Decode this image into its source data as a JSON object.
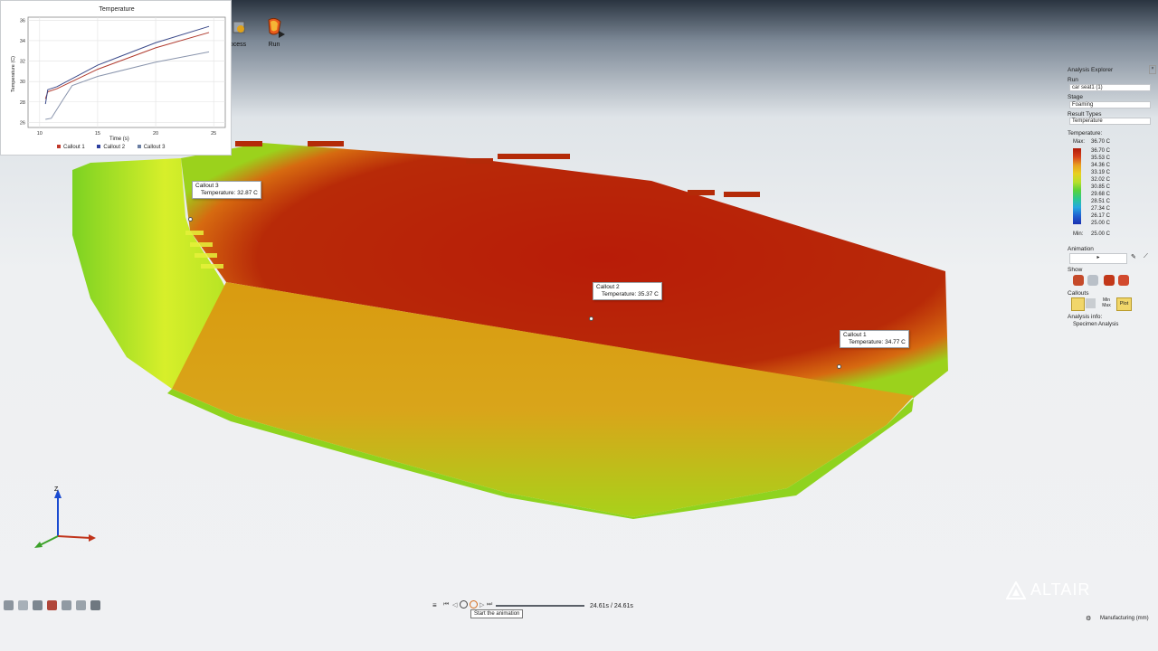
{
  "chart": {
    "title": "Temperature",
    "ylabel": "Temperature (C)",
    "xlabel": "Time (s)",
    "yticks": [
      "36",
      "34",
      "32",
      "30",
      "28",
      "26"
    ],
    "xticks": [
      "10",
      "15",
      "20",
      "25"
    ],
    "legend": [
      {
        "label": "Callout 1",
        "color": "#c0392b"
      },
      {
        "label": "Callout 2",
        "color": "#2c3e9e"
      },
      {
        "label": "Callout 3",
        "color": "#6b7fa3"
      }
    ]
  },
  "chart_data": {
    "type": "line",
    "title": "Temperature",
    "xlabel": "Time (s)",
    "ylabel": "Temperature (C)",
    "xlim": [
      9,
      26
    ],
    "ylim": [
      25.5,
      36.3
    ],
    "grid": true,
    "legend": "bottom",
    "series": [
      {
        "name": "Callout 1",
        "color": "#b03a2e",
        "x": [
          10.5,
          10.7,
          11.5,
          15,
          20,
          24.6
        ],
        "y": [
          28.3,
          29.0,
          29.3,
          31.2,
          33.3,
          34.8
        ]
      },
      {
        "name": "Callout 2",
        "color": "#3b4a8a",
        "x": [
          10.5,
          10.7,
          11.5,
          15,
          20,
          24.6
        ],
        "y": [
          27.8,
          29.2,
          29.5,
          31.6,
          33.8,
          35.4
        ]
      },
      {
        "name": "Callout 3",
        "color": "#8a95ad",
        "x": [
          10.5,
          11.0,
          12.0,
          12.8,
          15,
          20,
          24.6
        ],
        "y": [
          26.3,
          26.4,
          28.2,
          29.6,
          30.5,
          31.9,
          32.9
        ]
      }
    ]
  },
  "ribbon": {
    "process_label": "ocess",
    "run_label": "Run"
  },
  "callouts": [
    {
      "title": "Callout 3",
      "temp": "Temperature: 32.87 C"
    },
    {
      "title": "Callout 2",
      "temp": "Temperature: 35.37 C"
    },
    {
      "title": "Callout 1",
      "temp": "Temperature: 34.77 C"
    }
  ],
  "explorer": {
    "title": "Analysis Explorer",
    "run_label": "Run",
    "run_value": "car seat1 (1)",
    "stage_label": "Stage",
    "stage_value": "Foaming",
    "result_types_label": "Result Types",
    "result_types_value": "Temperature",
    "legend_title": "Temperature:",
    "max_label": "Max:",
    "max_value": "36.70 C",
    "min_label": "Min:",
    "min_value": "25.00 C",
    "legend_values": [
      "36.70 C",
      "35.53 C",
      "34.36 C",
      "33.19 C",
      "32.02 C",
      "30.85 C",
      "29.68 C",
      "28.51 C",
      "27.34 C",
      "26.17 C",
      "25.00 C"
    ],
    "animation_label": "Animation",
    "show_label": "Show",
    "callouts_label": "Callouts",
    "minmax_label_top": "Min",
    "minmax_label_bottom": "Max",
    "plot_label": "Plot",
    "analysis_info_label": "Analysis info:",
    "analysis_info_value": "Specimen Analysis"
  },
  "playback": {
    "time": "24.61s / 24.61s",
    "tooltip": "Start the animation",
    "progress": 1.0
  },
  "brand": "ALTAIR",
  "status": "Manufacturing (mm)",
  "axes": {
    "z": "Z"
  }
}
